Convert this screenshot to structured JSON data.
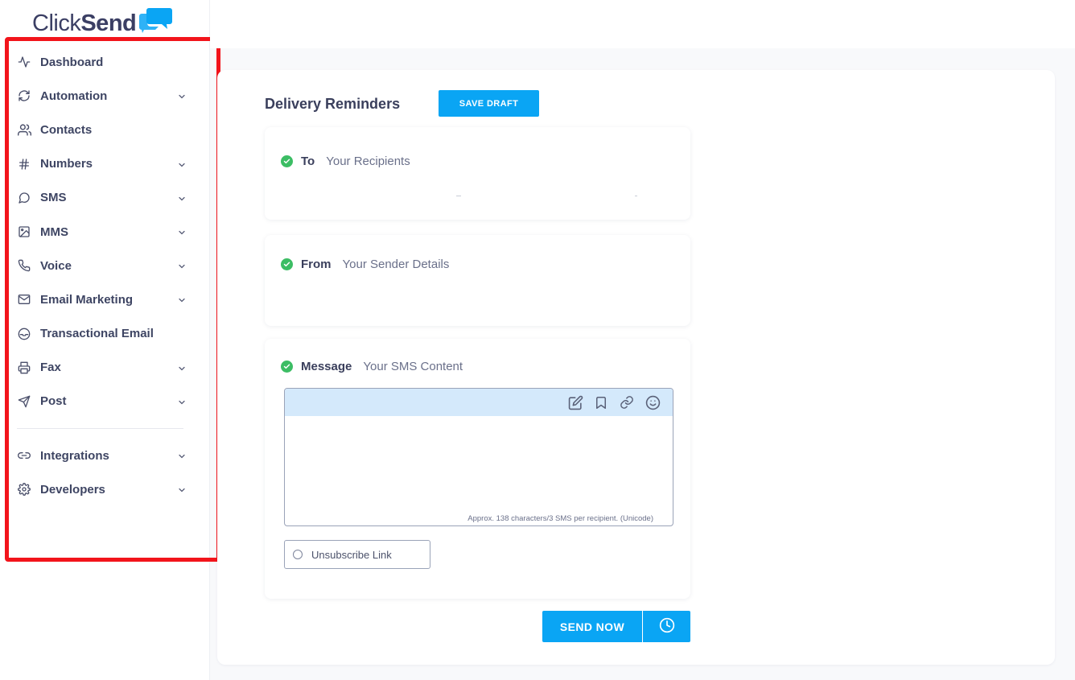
{
  "brand": {
    "name_light": "Click",
    "name_bold": "Send",
    "accent": "#0aa5f4"
  },
  "sidebar": {
    "items": [
      {
        "label": "Dashboard",
        "icon": "activity-icon",
        "expandable": false
      },
      {
        "label": "Automation",
        "icon": "refresh-icon",
        "expandable": true
      },
      {
        "label": "Contacts",
        "icon": "users-icon",
        "expandable": false
      },
      {
        "label": "Numbers",
        "icon": "hash-icon",
        "expandable": true
      },
      {
        "label": "SMS",
        "icon": "message-circle-icon",
        "expandable": true
      },
      {
        "label": "MMS",
        "icon": "image-icon",
        "expandable": true
      },
      {
        "label": "Voice",
        "icon": "phone-icon",
        "expandable": true
      },
      {
        "label": "Email Marketing",
        "icon": "mail-icon",
        "expandable": true
      },
      {
        "label": "Transactional Email",
        "icon": "inbox-icon",
        "expandable": false
      },
      {
        "label": "Fax",
        "icon": "printer-icon",
        "expandable": true
      },
      {
        "label": "Post",
        "icon": "send-icon",
        "expandable": true
      }
    ],
    "secondary_items": [
      {
        "label": "Integrations",
        "icon": "link-icon",
        "expandable": true
      },
      {
        "label": "Developers",
        "icon": "settings-icon",
        "expandable": true
      }
    ]
  },
  "main": {
    "title": "Delivery Reminders",
    "save_draft_label": "SAVE DRAFT",
    "to": {
      "label": "To",
      "sub": "Your Recipients"
    },
    "from": {
      "label": "From",
      "sub": "Your Sender Details"
    },
    "message": {
      "label": "Message",
      "sub": "Your SMS Content",
      "toolbar": [
        "edit-icon",
        "bookmark-icon",
        "link-icon",
        "smile-icon"
      ],
      "char_count": "Approx. 138 characters/3 SMS per recipient. (Unicode)"
    },
    "unsubscribe_label": "Unsubscribe Link",
    "send_now_label": "SEND NOW",
    "colors": {
      "check": "#3cbd64",
      "button": "#0aa5f4",
      "editor_bar": "#d4e9fb",
      "highlight": "#f2141b"
    }
  }
}
